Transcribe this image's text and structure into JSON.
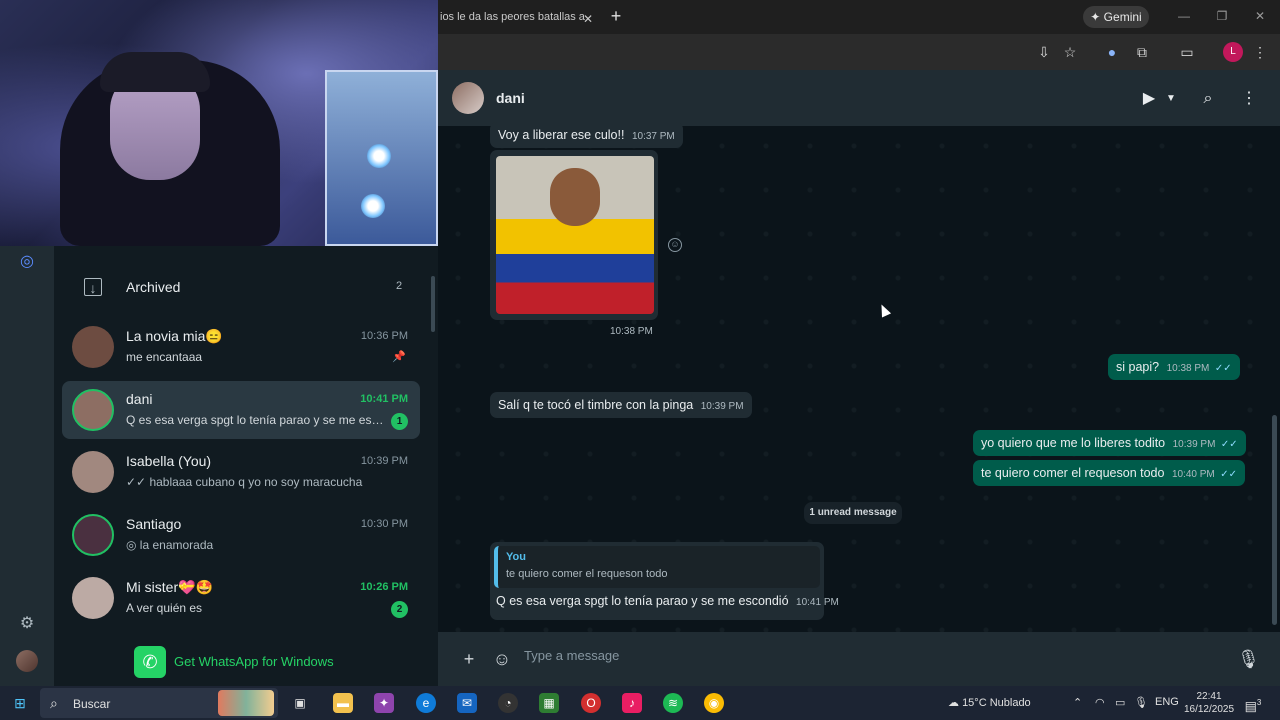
{
  "browser": {
    "tab_title": "ios le da las peores batallas a",
    "tab_close": "✕",
    "new_tab": "+",
    "gemini_label": "✦ Gemini",
    "profile_initial": "L",
    "window_buttons": [
      "—",
      "❐",
      "✕"
    ]
  },
  "sidebar": {
    "archived": {
      "label": "Archived",
      "count": "2"
    },
    "chats": [
      {
        "name": "La novia mia😑",
        "time": "10:36 PM",
        "preview": "me encantaaa",
        "pinned": true,
        "avatar_color": "#6d4c41"
      },
      {
        "name": "dani",
        "time": "10:41 PM",
        "preview": "Q es esa verga spgt lo tenía parao y se me esco...",
        "unread": "1",
        "active": true,
        "avatar_color": "#8d6e63"
      },
      {
        "name": "Isabella (You)",
        "time": "10:39 PM",
        "preview": "✓✓ hablaaa cubano q yo no soy maracucha",
        "avatar_color": "#a1887f"
      },
      {
        "name": "Santiago",
        "time": "10:30 PM",
        "preview": "◎ la enamorada",
        "avatar_color": "#4a3040"
      },
      {
        "name": "Mi sister💝🤩",
        "time": "10:26 PM",
        "preview": "A ver quién es",
        "unread": "2",
        "avatar_color": "#bcaaa4"
      }
    ],
    "get_whatsapp": "Get WhatsApp for Windows"
  },
  "conversation": {
    "contact_name": "dani",
    "messages": {
      "m1_text": "Voy a liberar ese culo!!",
      "m1_time": "10:37 PM",
      "img_time": "10:38 PM",
      "m2_text": "si papi?",
      "m2_time": "10:38 PM",
      "m3_text": "Salí q te tocó el timbre con la pinga",
      "m3_time": "10:39 PM",
      "m4_text": "yo quiero que me lo liberes todito",
      "m4_time": "10:39 PM",
      "m5_text": "te quiero comer el requeson todo",
      "m5_time": "10:40 PM",
      "unread_label": "1 unread message",
      "reply_who": "You",
      "reply_quote": "te quiero comer el requeson todo",
      "reply_body": "Q es esa verga spgt lo tenía parao y se me escondió",
      "reply_time": "10:41 PM",
      "ticks": "✓✓"
    },
    "compose_placeholder": "Type a message"
  },
  "taskbar": {
    "search_placeholder": "Buscar",
    "weather": "15°C  Nublado",
    "language": "ENG",
    "time": "22:41",
    "date": "16/12/2025",
    "notif_count": "3"
  },
  "colors": {
    "accent_green": "#21c063",
    "bubble_out": "#005c4b",
    "bubble_in": "#202c33",
    "link_blue": "#53bdeb"
  }
}
